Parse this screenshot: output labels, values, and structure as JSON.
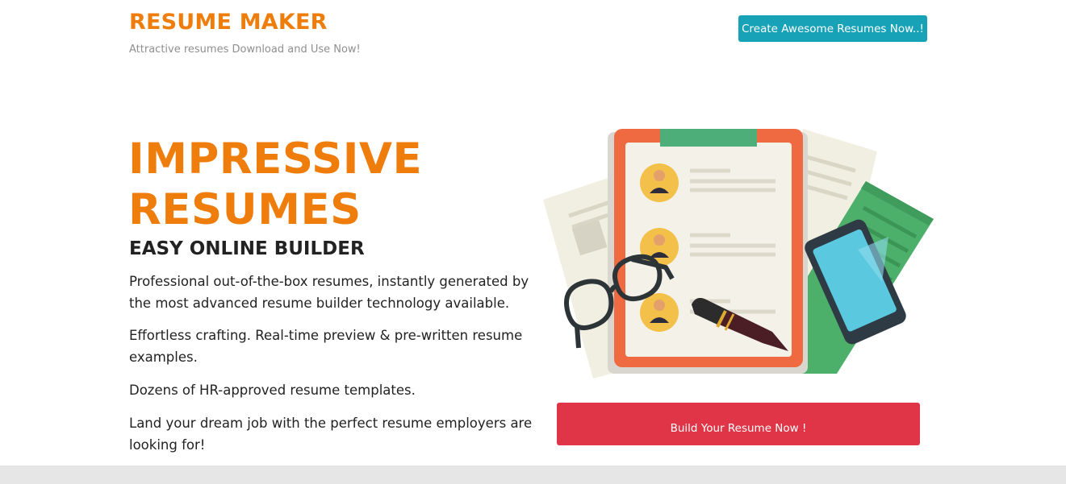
{
  "header": {
    "brand_title": "RESUME MAKER",
    "tagline": "Attractive resumes Download and Use Now!",
    "cta_label": "Create Awesome Resumes Now..!"
  },
  "hero": {
    "title_line1": "IMPRESSIVE",
    "title_line2": "RESUMES",
    "subtitle": "EASY ONLINE BUILDER",
    "points": [
      "Professional out-of-the-box resumes, instantly generated by the most advanced resume builder technology available.",
      "Effortless crafting. Real-time preview & pre-written resume examples.",
      "Dozens of HR-approved resume templates.",
      "Land your dream job with the perfect resume employers are looking for!"
    ],
    "build_button_label": "Build Your Resume Now !"
  },
  "illustration": {
    "icon": "resume-clipboard-illustration",
    "colors": {
      "clipboard": "#ef6a40",
      "clip": "#4dae79",
      "paper": "#f4f2e8",
      "avatar_bg": "#f3c04a",
      "phone_screen": "#5ac8de",
      "green_sheet": "#4caf6a",
      "pen": "#2c2c2c"
    }
  },
  "theme": {
    "brand_orange": "#ef7d0b",
    "cta_teal": "#17a2b8",
    "build_red": "#e03546",
    "footer_gray": "#e6e6e6"
  }
}
